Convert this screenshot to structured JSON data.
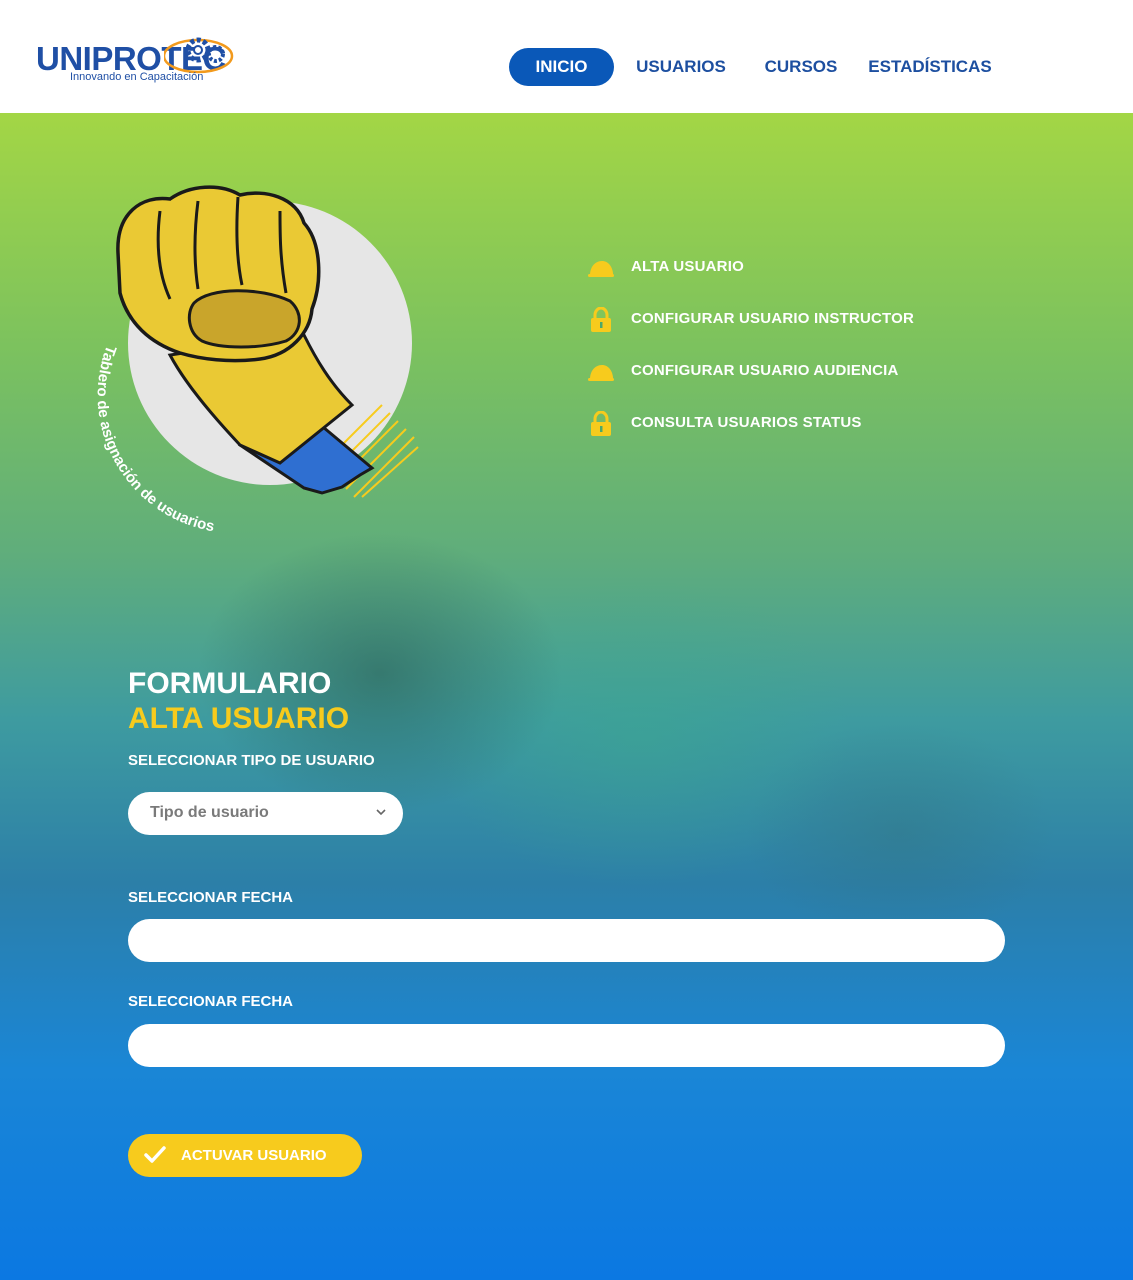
{
  "header": {
    "logo_text": "UNIPROTEC",
    "logo_tagline": "Innovando en Capacitación",
    "nav": [
      {
        "label": "INICIO",
        "active": true
      },
      {
        "label": "USUARIOS",
        "active": false
      },
      {
        "label": "CURSOS",
        "active": false
      },
      {
        "label": "ESTADÍSTICAS",
        "active": false
      }
    ]
  },
  "hero": {
    "circle_caption": "Tablero de asignación de usuarios",
    "menu": [
      {
        "label": "ALTA USUARIO",
        "icon": "hard-hat-icon"
      },
      {
        "label": "CONFIGURAR USUARIO INSTRUCTOR",
        "icon": "lock-icon"
      },
      {
        "label": "CONFIGURAR USUARIO AUDIENCIA",
        "icon": "hard-hat-icon"
      },
      {
        "label": "CONSULTA USUARIOS STATUS",
        "icon": "lock-icon"
      }
    ]
  },
  "form": {
    "title_line1": "FORMULARIO",
    "title_line2": "ALTA USUARIO",
    "user_type_label": "SELECCIONAR TIPO DE USUARIO",
    "user_type_value": "Tipo de usuario",
    "date1_label": "SELECCIONAR FECHA",
    "date1_value": "",
    "date2_label": "SELECCIONAR FECHA",
    "date2_value": "",
    "submit_label": "ACTUVAR USUARIO"
  },
  "colors": {
    "brand_blue": "#1d4fa0",
    "nav_active": "#0a58b8",
    "accent_yellow": "#f7cb1d"
  }
}
